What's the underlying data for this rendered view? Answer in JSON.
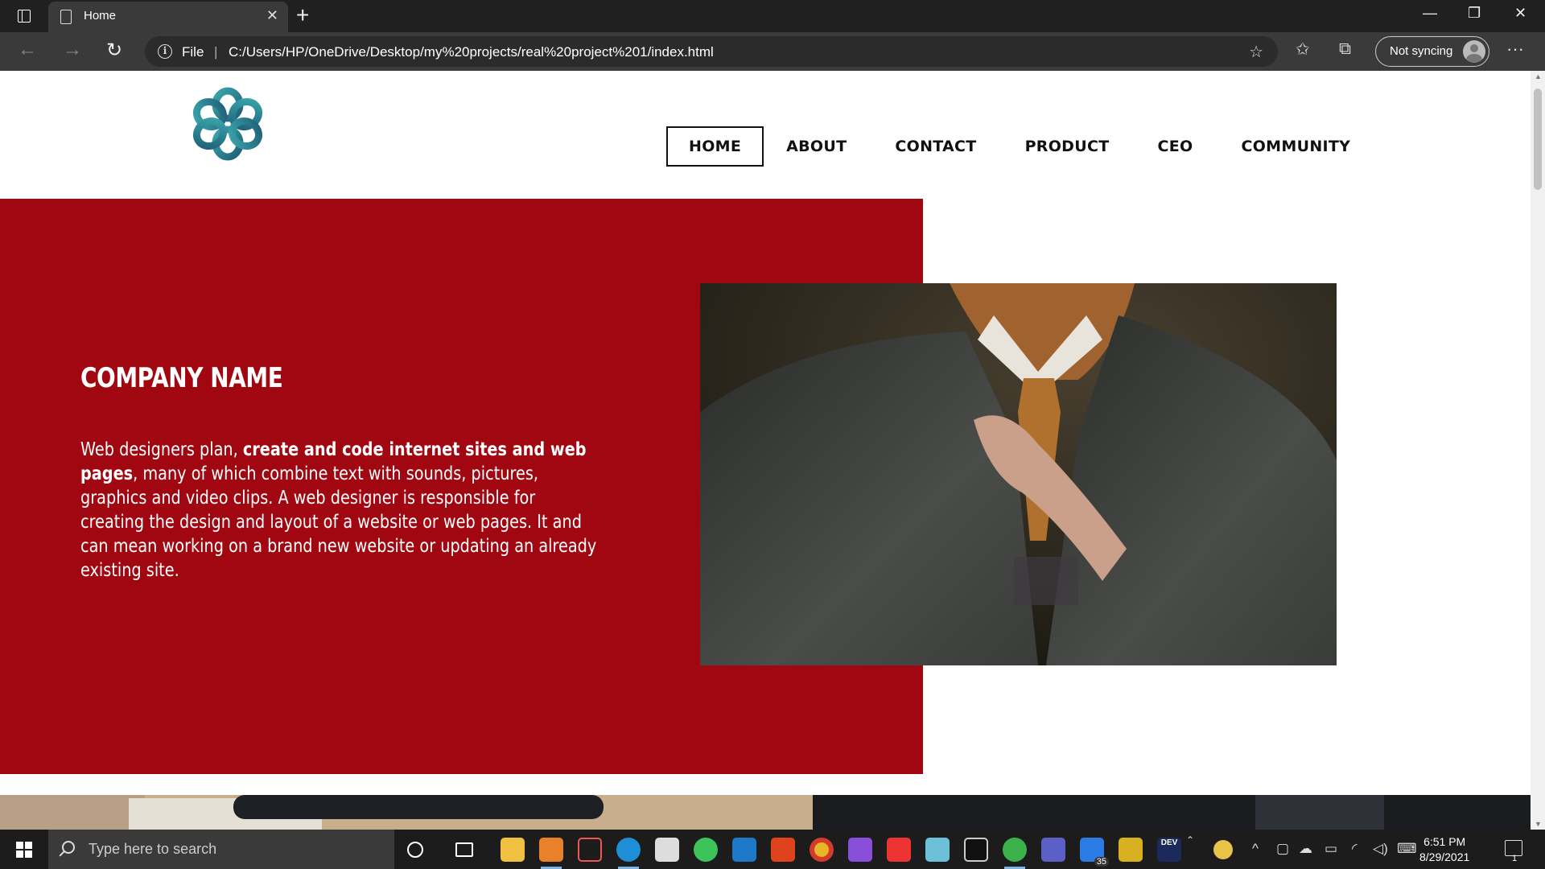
{
  "browser": {
    "tab_title": "Home",
    "tab_close": "✕",
    "new_tab": "+",
    "address_prefix": "File",
    "address_separator": "|",
    "url": "C:/Users/HP/OneDrive/Desktop/my%20projects/real%20project%201/index.html",
    "sync_label": "Not syncing",
    "more_label": "···",
    "window_minimize": "—",
    "window_restore": "❐",
    "window_close": "✕"
  },
  "site": {
    "nav": [
      {
        "label": "HOME",
        "active": true
      },
      {
        "label": "ABOUT",
        "active": false
      },
      {
        "label": "CONTACT",
        "active": false
      },
      {
        "label": "PRODUCT",
        "active": false
      },
      {
        "label": "CEO",
        "active": false
      },
      {
        "label": "COMMUNITY",
        "active": false
      }
    ],
    "hero": {
      "company_name": "COMPANY NAME",
      "desc_intro": "Web designers plan, ",
      "desc_bold": "create and code internet sites and web pages",
      "desc_rest": ", many of which combine text with sounds, pictures, graphics and video clips. A web designer is responsible for creating the design and layout of a website or web pages. It and can mean working on a brand new website or updating an already existing site."
    },
    "colors": {
      "hero_red": "#a10711",
      "logo_teal": "#2f8f98"
    }
  },
  "taskbar": {
    "search_placeholder": "Type here to search",
    "time": "6:51 PM",
    "date": "8/29/2021",
    "badge_count": "35",
    "notification_count": "1",
    "dev_label": "DEV"
  }
}
